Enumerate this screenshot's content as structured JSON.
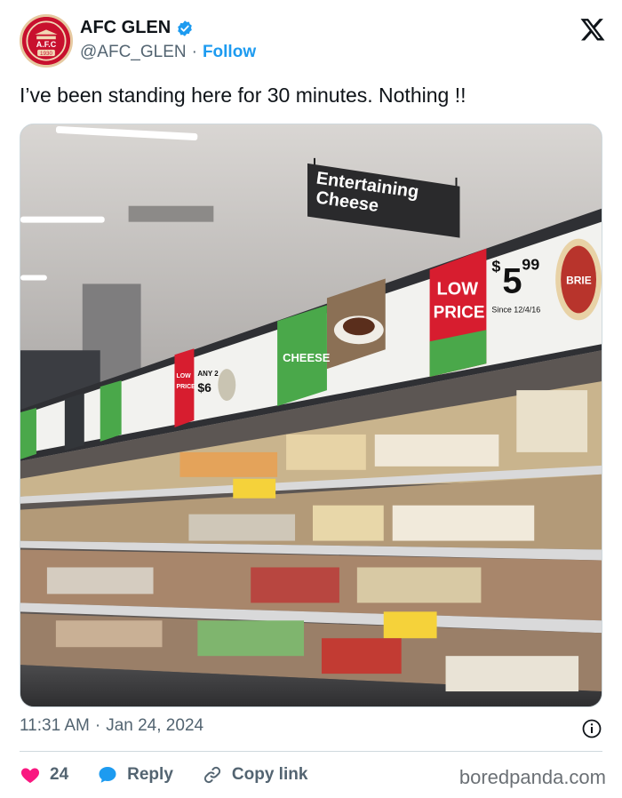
{
  "author": {
    "display_name": "AFC GLEN",
    "handle": "@AFC_GLEN",
    "separator": "·",
    "follow_label": "Follow",
    "avatar_text_top": "A.F.C",
    "avatar_text_year": "1930"
  },
  "tweet": {
    "text": "I’ve been standing here for 30 minutes. Nothing !!"
  },
  "media": {
    "aisle_sign_line1": "Entertaining",
    "aisle_sign_line2": "Cheese",
    "low_price_line1": "LOW",
    "low_price_line2": "PRICE",
    "price_dollar": "$",
    "price_main": "5",
    "price_cents": "99",
    "price_since": "Since 12/4/16",
    "brie_label": "BRIE",
    "cheese_panel": "CHEESE",
    "small_low": "LOW",
    "small_price": "PRICE",
    "small_any": "ANY 2",
    "small_amount": "$6"
  },
  "meta": {
    "time": "11:31 AM",
    "separator": "·",
    "date": "Jan 24, 2024"
  },
  "actions": {
    "like_count": "24",
    "reply_label": "Reply",
    "copy_link_label": "Copy link"
  },
  "watermark": "boredpanda.com",
  "colors": {
    "like": "#f91880",
    "reply": "#1d9bf0",
    "verified": "#1d9bf0",
    "follow": "#1d9bf0",
    "price_red": "#d71d2f",
    "cheese_green": "#4aa84a"
  }
}
